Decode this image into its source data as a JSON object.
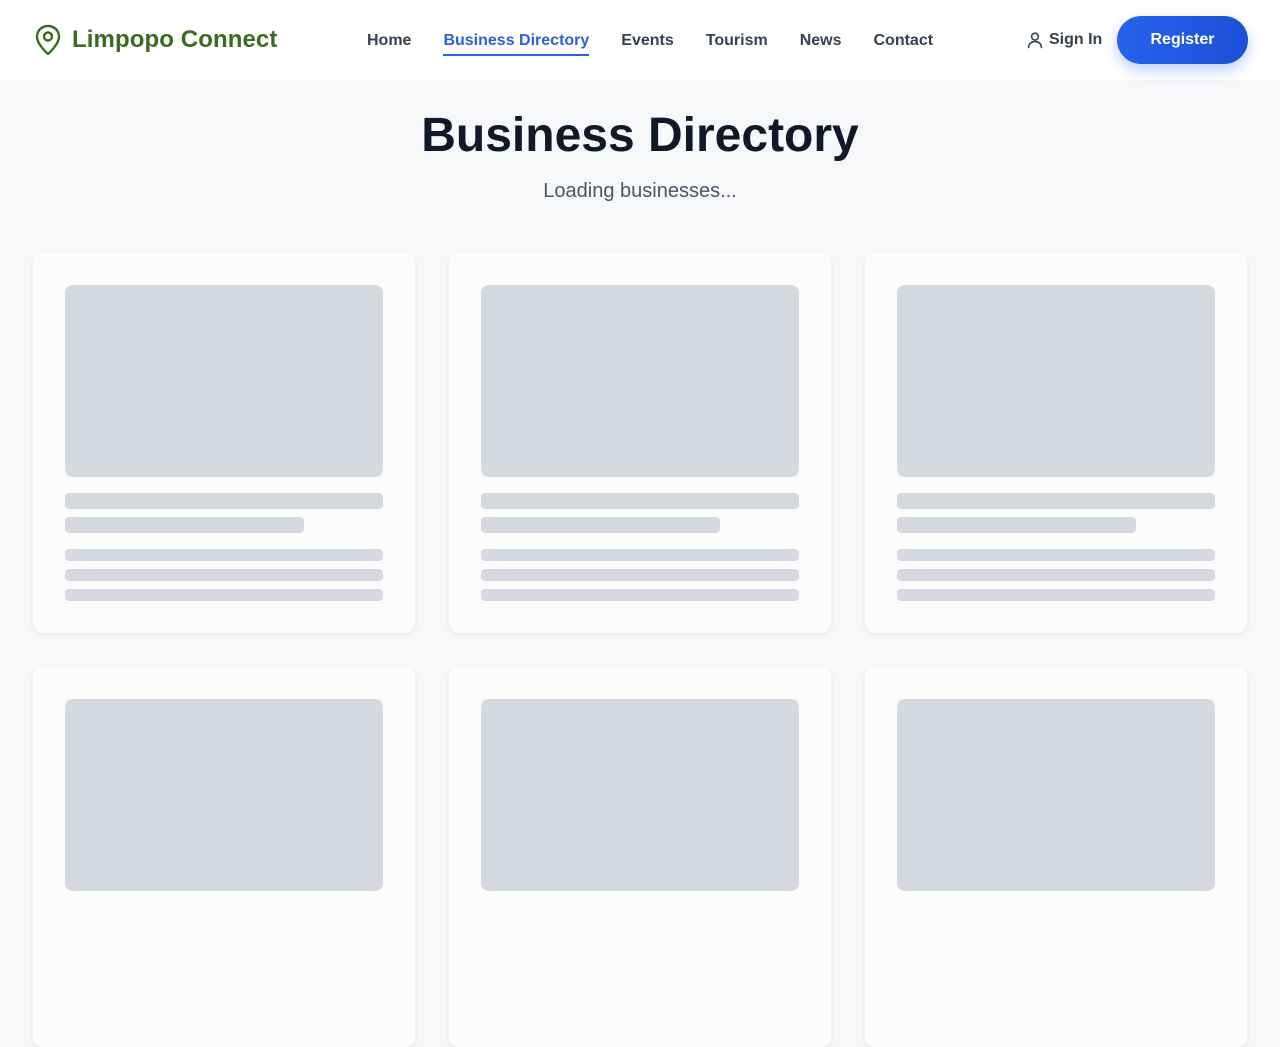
{
  "brand": {
    "name": "Limpopo Connect",
    "icon": "map-pin-icon",
    "color": "#3b6b23"
  },
  "nav": {
    "items": [
      {
        "label": "Home",
        "active": false
      },
      {
        "label": "Business Directory",
        "active": true
      },
      {
        "label": "Events",
        "active": false
      },
      {
        "label": "Tourism",
        "active": false
      },
      {
        "label": "News",
        "active": false
      },
      {
        "label": "Contact",
        "active": false
      }
    ],
    "active_color": "#2b61db"
  },
  "auth": {
    "sign_in_label": "Sign In",
    "sign_in_icon": "user-icon",
    "register_label": "Register",
    "register_color": "#2563eb"
  },
  "main": {
    "title": "Business Directory",
    "subtitle": "Loading businesses...",
    "skeleton_color": "#d6d9df"
  }
}
